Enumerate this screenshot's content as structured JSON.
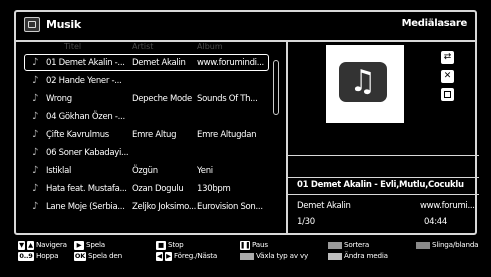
{
  "header": {
    "title": "Musik",
    "mode": "Mediälasare"
  },
  "columns": {
    "title": "Titel",
    "artist": "Artist",
    "album": "Album"
  },
  "tracks": [
    {
      "title": "01 Demet Akalin -...",
      "artist": "Demet Akalin",
      "album": "www.forumindi...",
      "selected": true
    },
    {
      "title": "02 Hande Yener -...",
      "artist": "",
      "album": ""
    },
    {
      "title": "Wrong",
      "artist": "Depeche Mode",
      "album": "Sounds Of Th..."
    },
    {
      "title": "04 Gökhan Özen -...",
      "artist": "",
      "album": ""
    },
    {
      "title": "Çifte Kavrulmus",
      "artist": "Emre Altug",
      "album": "Emre Altugdan"
    },
    {
      "title": "06 Soner Kabadayi...",
      "artist": "",
      "album": ""
    },
    {
      "title": "Istiklal",
      "artist": "Özgün",
      "album": "Yeni"
    },
    {
      "title": "Hata feat. Mustafa...",
      "artist": "Ozan Dogulu",
      "album": "130bpm"
    },
    {
      "title": "Lane Moje (Serbia...",
      "artist": "Zeljko Joksimo...",
      "album": "Eurovision Son..."
    }
  ],
  "now_playing": {
    "title": "01 Demet Akalin - Evli,Mutlu,Cocuklu",
    "artist": "Demet Akalin",
    "album": "www.forumi...",
    "position": "1/30",
    "duration": "04:44"
  },
  "footer": {
    "navigate": "Navigera",
    "jump": "Hoppa",
    "play": "Spela",
    "play_this": "Spela den",
    "stop": "Stop",
    "prev_next": "Föreg./Nästa",
    "pause": "Paus",
    "switch_view": "Växla typ av vy",
    "sort": "Sortera",
    "edit_media": "Ändra media",
    "loop": "Slinga/blanda",
    "ok_key": "OK",
    "jump_key": "0..9"
  }
}
